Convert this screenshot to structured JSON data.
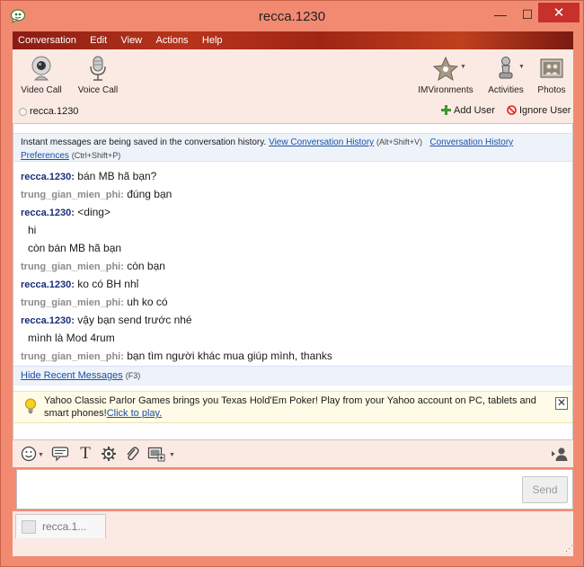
{
  "window": {
    "title": "recca.1230",
    "app_icon": "yahoo-messenger-icon",
    "minimize_glyph": "—",
    "maximize_glyph": "☐",
    "close_glyph": "✕"
  },
  "menu": [
    "Conversation",
    "Edit",
    "View",
    "Actions",
    "Help"
  ],
  "toolbar": {
    "video_call": "Video Call",
    "voice_call": "Voice Call",
    "imvironments": "IMVironments",
    "activities": "Activities",
    "photos": "Photos"
  },
  "contact": {
    "name": "recca.1230",
    "add_user": "Add User",
    "ignore_user": "Ignore User"
  },
  "history_notice": {
    "text": "Instant messages are being saved in the conversation history.",
    "view_link": "View Conversation History",
    "view_shortcut": "(Alt+Shift+V)",
    "prefs_link_1": "Conversation History",
    "prefs_link_2": "Preferences",
    "prefs_shortcut": "(Ctrl+Shift+P)"
  },
  "messages": [
    {
      "sender": "recca.1230:",
      "self": true,
      "text": " bán MB hã bạn?"
    },
    {
      "sender": "trung_gian_mien_phi:",
      "self": false,
      "text": " đúng bạn"
    },
    {
      "sender": "recca.1230:",
      "self": true,
      "text": " <ding>"
    },
    {
      "sender": "",
      "self": true,
      "text": "hi"
    },
    {
      "sender": "",
      "self": true,
      "text": "còn bán MB hã bạn"
    },
    {
      "sender": "trung_gian_mien_phi:",
      "self": false,
      "text": " còn bạn"
    },
    {
      "sender": "recca.1230:",
      "self": true,
      "text": " ko có BH nhỉ"
    },
    {
      "sender": "trung_gian_mien_phi:",
      "self": false,
      "text": " uh ko có"
    },
    {
      "sender": "recca.1230:",
      "self": true,
      "text": " vậy bạn send trước nhé"
    },
    {
      "sender": "",
      "self": true,
      "text": "mình là Mod 4rum"
    },
    {
      "sender": "trung_gian_mien_phi:",
      "self": false,
      "text": " bạn tìm người khác mua giúp mình, thanks"
    }
  ],
  "hide_recent": {
    "link": "Hide Recent Messages",
    "shortcut": "(F3)"
  },
  "ad": {
    "text": "Yahoo Classic Parlor Games brings you Texas Hold'Em Poker! Play from your Yahoo account on PC, tablets and smart phones!",
    "link": "Click to play.",
    "close_glyph": "✕"
  },
  "compose": {
    "value": "",
    "send_label": "Send"
  },
  "tabs": [
    {
      "label": "recca.1..."
    }
  ],
  "colors": {
    "window_frame": "#f28a72",
    "menu_bar": "#a02614",
    "self_name": "#1a2d7a",
    "other_name": "#8a8a8a",
    "link": "#1a4fa6"
  }
}
